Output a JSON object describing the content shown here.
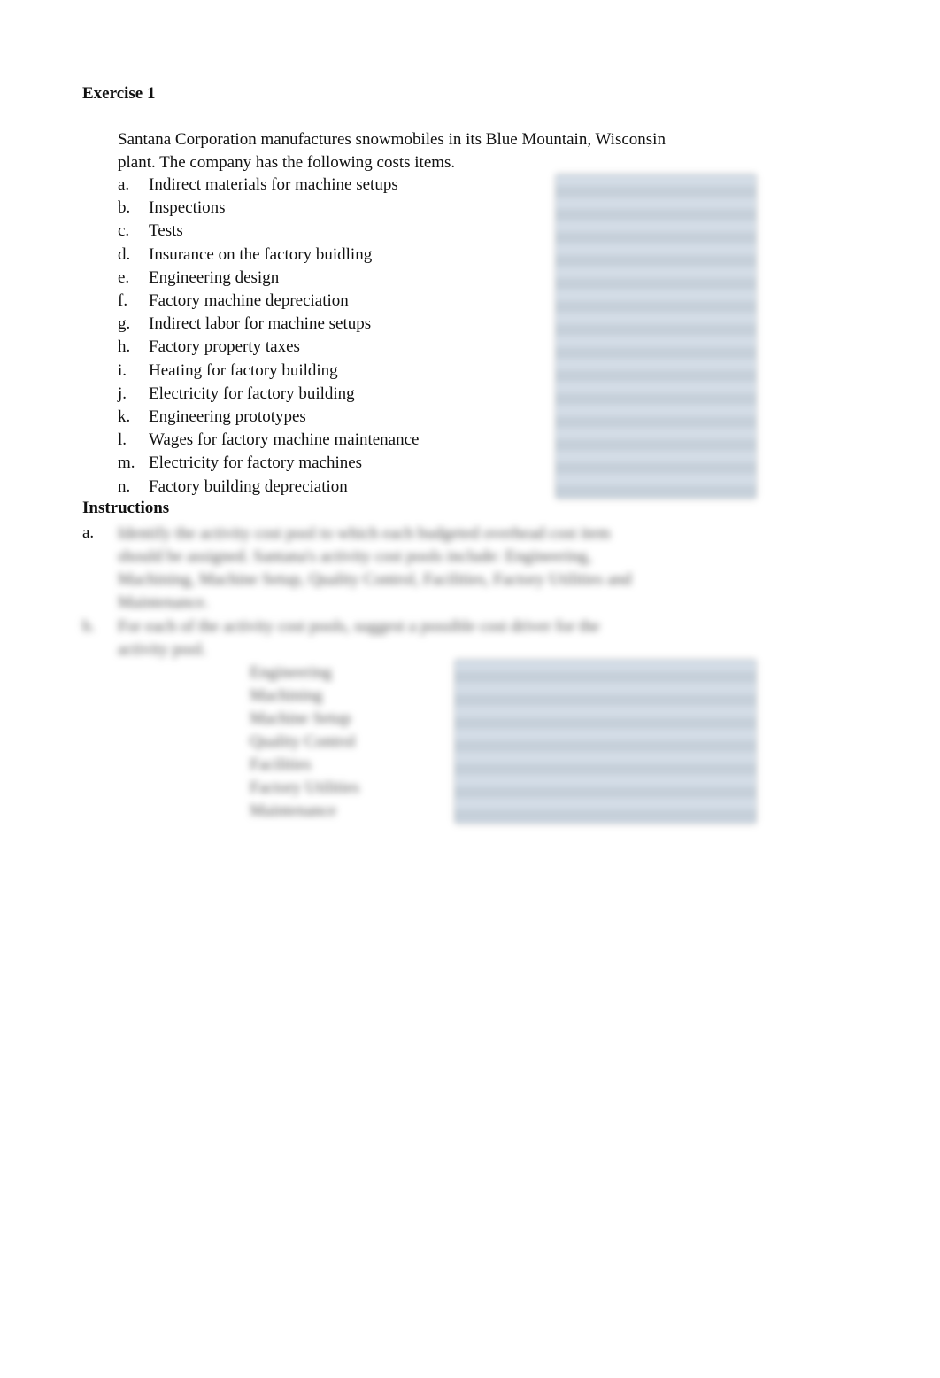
{
  "exercise": {
    "title": "Exercise 1",
    "intro_line1": "Santana Corporation manufactures snowmobiles in its Blue Mountain, Wisconsin",
    "intro_line2": "plant.  The company has the following costs items.",
    "items": [
      {
        "letter": "a.",
        "text": "Indirect materials for machine setups"
      },
      {
        "letter": "b.",
        "text": "Inspections"
      },
      {
        "letter": "c.",
        "text": "Tests"
      },
      {
        "letter": "d.",
        "text": "Insurance on the factory buidling"
      },
      {
        "letter": "e.",
        "text": "Engineering design"
      },
      {
        "letter": "f.",
        "text": "Factory machine depreciation"
      },
      {
        "letter": "g.",
        "text": "Indirect labor for machine setups"
      },
      {
        "letter": "h.",
        "text": "Factory property taxes"
      },
      {
        "letter": "i.",
        "text": "Heating for factory building"
      },
      {
        "letter": "j.",
        "text": "Electricity for factory building"
      },
      {
        "letter": "k.",
        "text": "Engineering prototypes"
      },
      {
        "letter": "l.",
        "text": "Wages for factory machine maintenance"
      },
      {
        "letter": "m.",
        "text": "Electricity for factory machines"
      },
      {
        "letter": "n.",
        "text": "Factory building depreciation"
      }
    ]
  },
  "instructions": {
    "title": "Instructions",
    "a_letter": "a.",
    "a_lines": [
      "Identify the activity cost pool to which each budgeted overhead cost item",
      "should be assigned. Santana's activity cost pools include: Engineering,",
      "Machining, Machine Setup, Quality Control, Facilities, Factory Utilities and",
      "Maintenance."
    ],
    "b_letter": "b.",
    "b_lines": [
      "For each of the activity cost pools, suggest a possible cost driver for the",
      "activity pool."
    ],
    "pools": [
      "Engineering",
      "Machining",
      "Machine Setup",
      "Quality Control",
      "Facilities",
      "Factory Utilities",
      "Maintenance"
    ]
  }
}
